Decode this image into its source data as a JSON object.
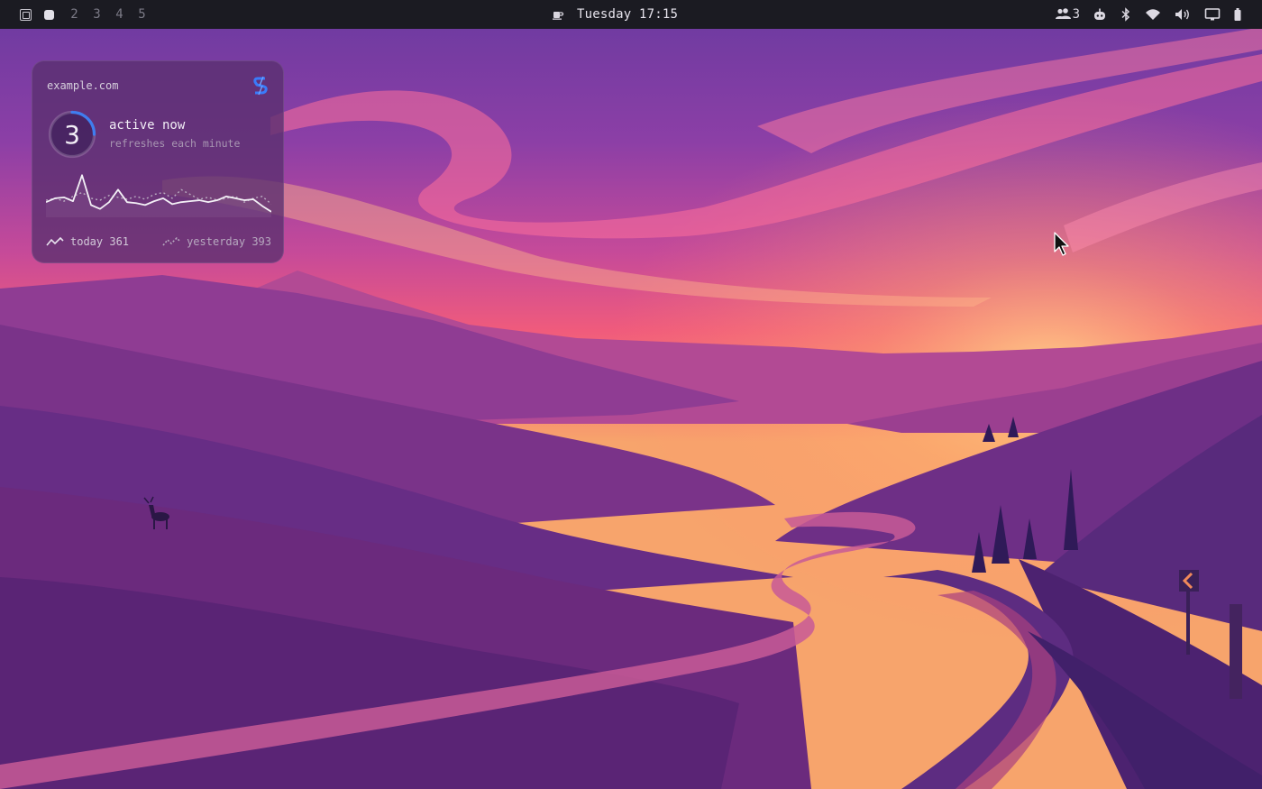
{
  "topbar": {
    "workspaces": [
      {
        "label": "",
        "icon": "window-frame-icon"
      },
      {
        "label": "",
        "icon": "square-filled-icon"
      },
      {
        "label": "2"
      },
      {
        "label": "3"
      },
      {
        "label": "4"
      },
      {
        "label": "5"
      }
    ],
    "clock": {
      "icon": "coffee-cup-icon",
      "text": "Tuesday 17:15"
    },
    "tray": {
      "users_count": "3",
      "icons": [
        "users-icon",
        "bot-icon",
        "bluetooth-icon",
        "wifi-icon",
        "volume-icon",
        "display-icon",
        "battery-icon"
      ]
    }
  },
  "widget": {
    "domain": "example.com",
    "logo_icon": "s-logo-icon",
    "count": "3",
    "count_progress": 0.25,
    "status": "active now",
    "subtitle": "refreshes each minute",
    "chart_data": {
      "type": "line",
      "series": [
        {
          "values": [
            12,
            16,
            17,
            13,
            40,
            9,
            5,
            12,
            25,
            12,
            11,
            9,
            13,
            16,
            10,
            12,
            13,
            14,
            12,
            14,
            18,
            16,
            14,
            15,
            8,
            2
          ]
        },
        {
          "values": [
            14,
            16,
            13,
            18,
            22,
            16,
            14,
            19,
            17,
            15,
            18,
            15,
            20,
            22,
            16,
            25,
            20,
            15,
            17,
            14,
            16,
            18,
            12,
            16,
            18,
            10
          ]
        }
      ]
    },
    "legend": {
      "today_label": "today 361",
      "yesterday_label": "yesterday 393"
    }
  },
  "colors": {
    "topbar_bg": "#1b1b22",
    "widget_bg": "#5a306e",
    "ring_accent": "#3f7df0",
    "logo_blue": "#3a7bfa"
  }
}
